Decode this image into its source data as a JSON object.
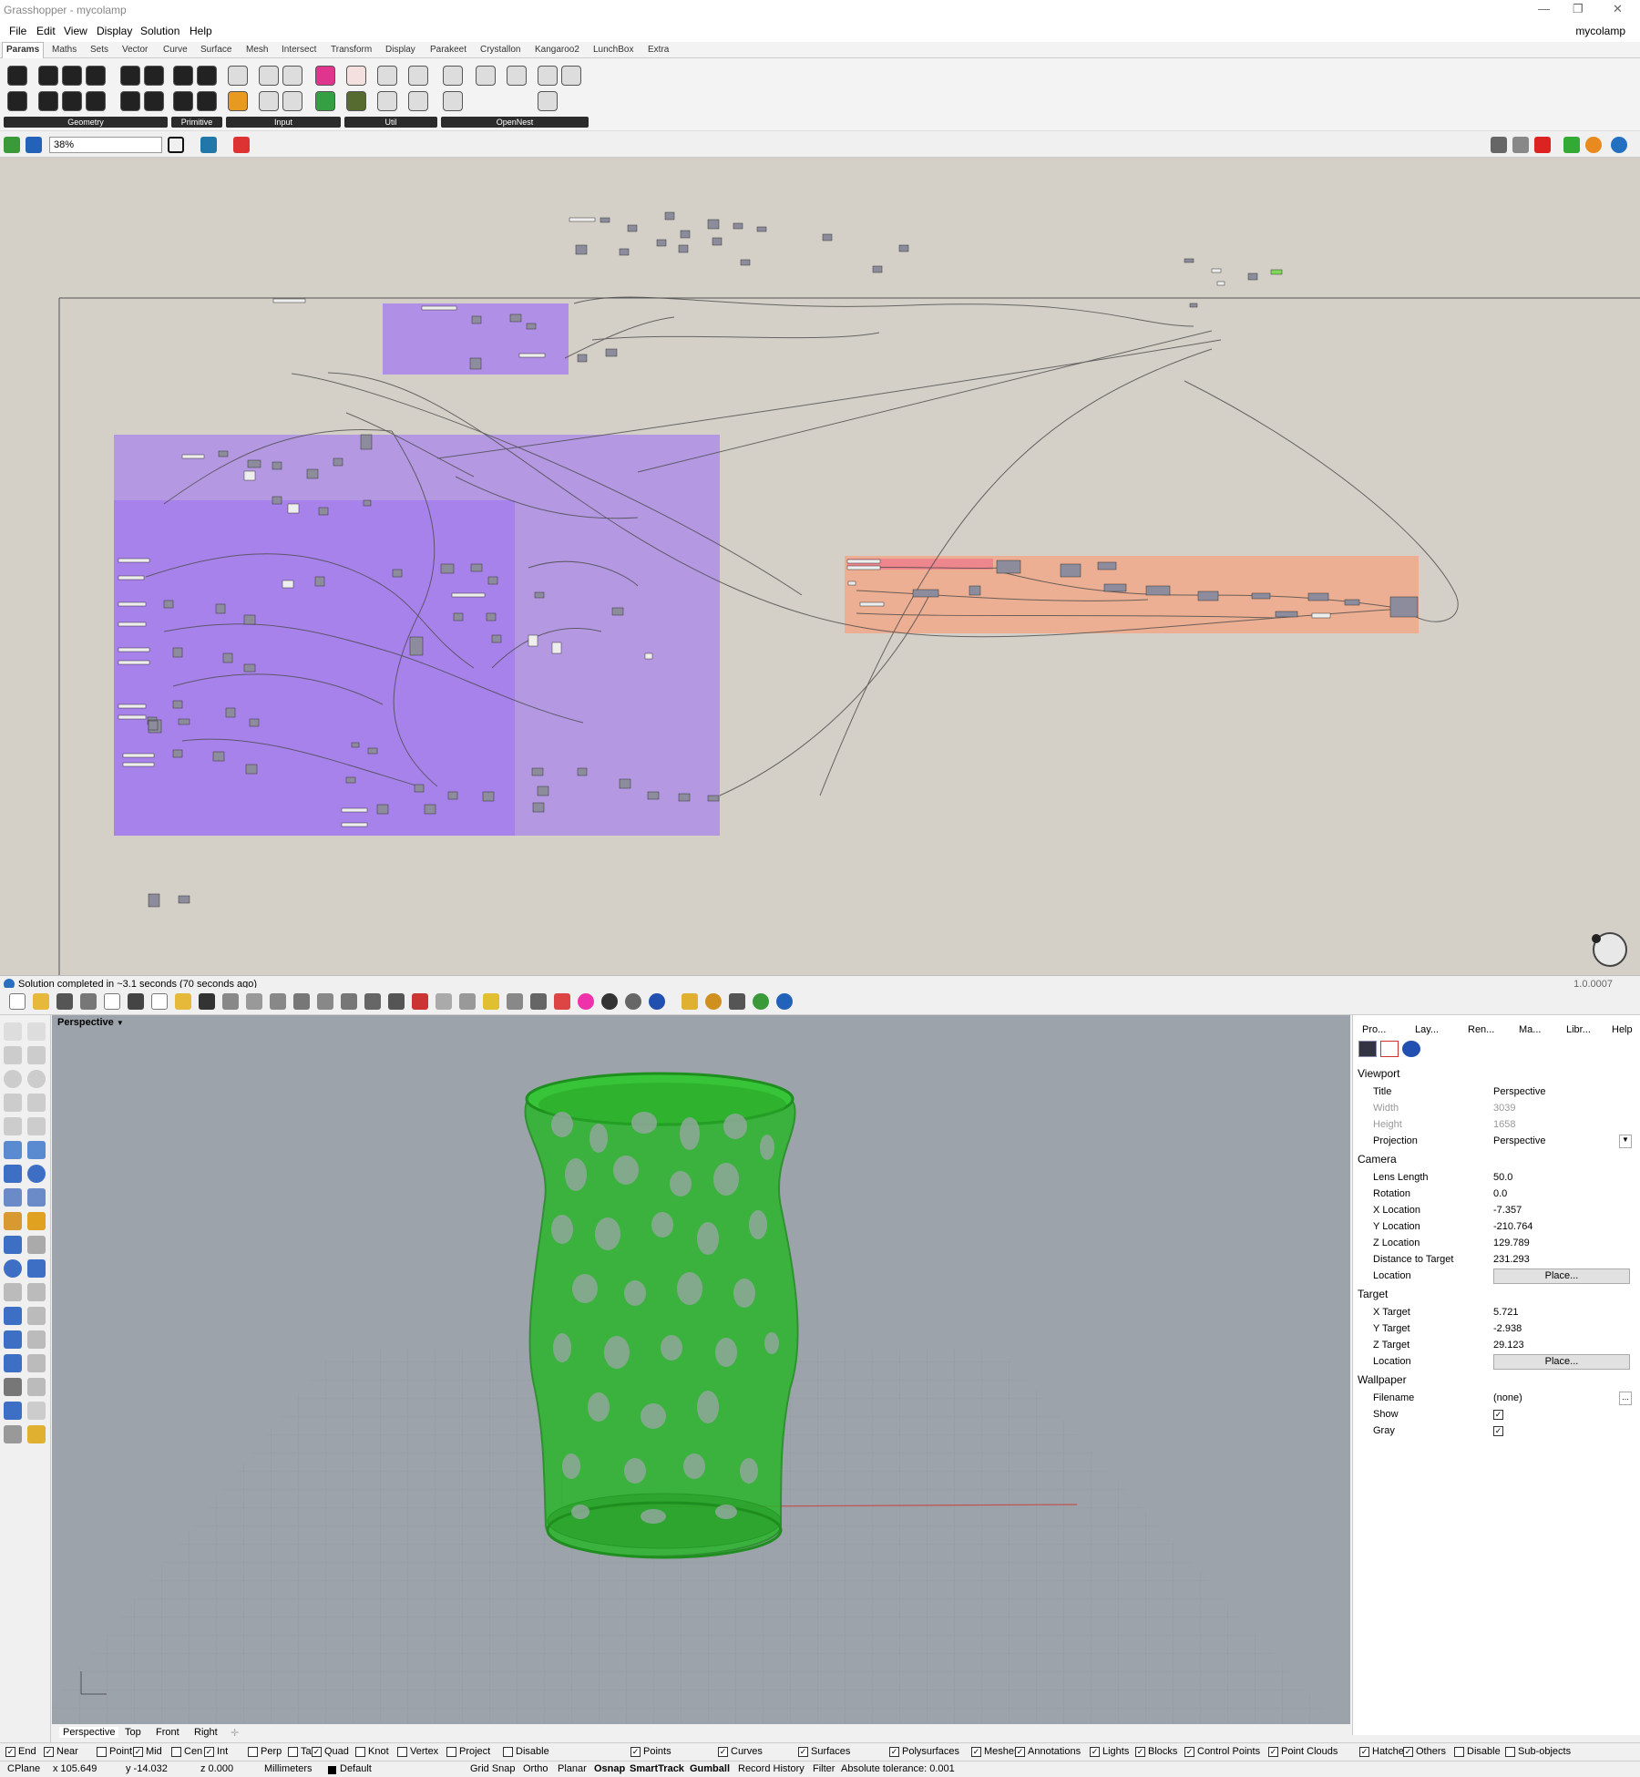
{
  "window": {
    "title": "Grasshopper - mycolamp",
    "doc_name": "mycolamp"
  },
  "menu": [
    "File",
    "Edit",
    "View",
    "Display",
    "Solution",
    "Help"
  ],
  "tabs": [
    "Params",
    "Maths",
    "Sets",
    "Vector",
    "Curve",
    "Surface",
    "Mesh",
    "Intersect",
    "Transform",
    "Display",
    "Parakeet",
    "Crystallon",
    "Kangaroo2",
    "LunchBox",
    "Extra"
  ],
  "ribbon_groups": [
    "Geometry",
    "Primitive",
    "Input",
    "Util",
    "OpenNest"
  ],
  "zoom": "38%",
  "canvas_status": "Solution completed in ~3.1 seconds (70 seconds ago)",
  "version": "1.0.0007",
  "viewport": {
    "name": "Perspective",
    "tabs": [
      "Perspective",
      "Top",
      "Front",
      "Right"
    ]
  },
  "panel_tabs": [
    "Pro...",
    "Lay...",
    "Ren...",
    "Ma...",
    "Libr...",
    "Help"
  ],
  "properties": {
    "viewport_header": "Viewport",
    "title_k": "Title",
    "title_v": "Perspective",
    "width_k": "Width",
    "width_v": "3039",
    "height_k": "Height",
    "height_v": "1658",
    "proj_k": "Projection",
    "proj_v": "Perspective",
    "camera_header": "Camera",
    "lens_k": "Lens Length",
    "lens_v": "50.0",
    "rot_k": "Rotation",
    "rot_v": "0.0",
    "xloc_k": "X Location",
    "xloc_v": "-7.357",
    "yloc_k": "Y Location",
    "yloc_v": "-210.764",
    "zloc_k": "Z Location",
    "zloc_v": "129.789",
    "dist_k": "Distance to Target",
    "dist_v": "231.293",
    "loc_k": "Location",
    "place": "Place...",
    "target_header": "Target",
    "xt_k": "X Target",
    "xt_v": "5.721",
    "yt_k": "Y Target",
    "yt_v": "-2.938",
    "zt_k": "Z Target",
    "zt_v": "29.123",
    "wall_header": "Wallpaper",
    "file_k": "Filename",
    "file_v": "(none)",
    "show_k": "Show",
    "gray_k": "Gray"
  },
  "osnaps": [
    {
      "label": "End",
      "on": true
    },
    {
      "label": "Near",
      "on": true
    },
    {
      "label": "Point",
      "on": false
    },
    {
      "label": "Mid",
      "on": true
    },
    {
      "label": "Cen",
      "on": false
    },
    {
      "label": "Int",
      "on": true
    },
    {
      "label": "Perp",
      "on": false
    },
    {
      "label": "Tan",
      "on": false
    },
    {
      "label": "Quad",
      "on": true
    },
    {
      "label": "Knot",
      "on": false
    },
    {
      "label": "Vertex",
      "on": false
    },
    {
      "label": "Project",
      "on": false
    },
    {
      "label": "Disable",
      "on": false
    }
  ],
  "filters": [
    "Points",
    "Curves",
    "Surfaces",
    "Polysurfaces",
    "Meshes",
    "Annotations",
    "Lights",
    "Blocks",
    "Control Points",
    "Point Clouds",
    "Hatches",
    "Others",
    "Disable",
    "Sub-objects"
  ],
  "coords": {
    "cplane": "CPlane",
    "x": "x 105.649",
    "y": "y -14.032",
    "z": "z 0.000",
    "units": "Millimeters",
    "layer": "Default",
    "grid_snap": "Grid Snap",
    "ortho": "Ortho",
    "planar": "Planar",
    "osnap": "Osnap",
    "smarttrack": "SmartTrack",
    "gumball": "Gumball",
    "history": "Record History",
    "filter": "Filter",
    "tolerance": "Absolute tolerance: 0.001"
  },
  "colors": {
    "canvas": "#d4d0c8",
    "group_purple": "#a37bf0",
    "group_orange": "#f0a989",
    "vase": "#2bb52b",
    "viewport_bg": "#9ca3ab"
  }
}
